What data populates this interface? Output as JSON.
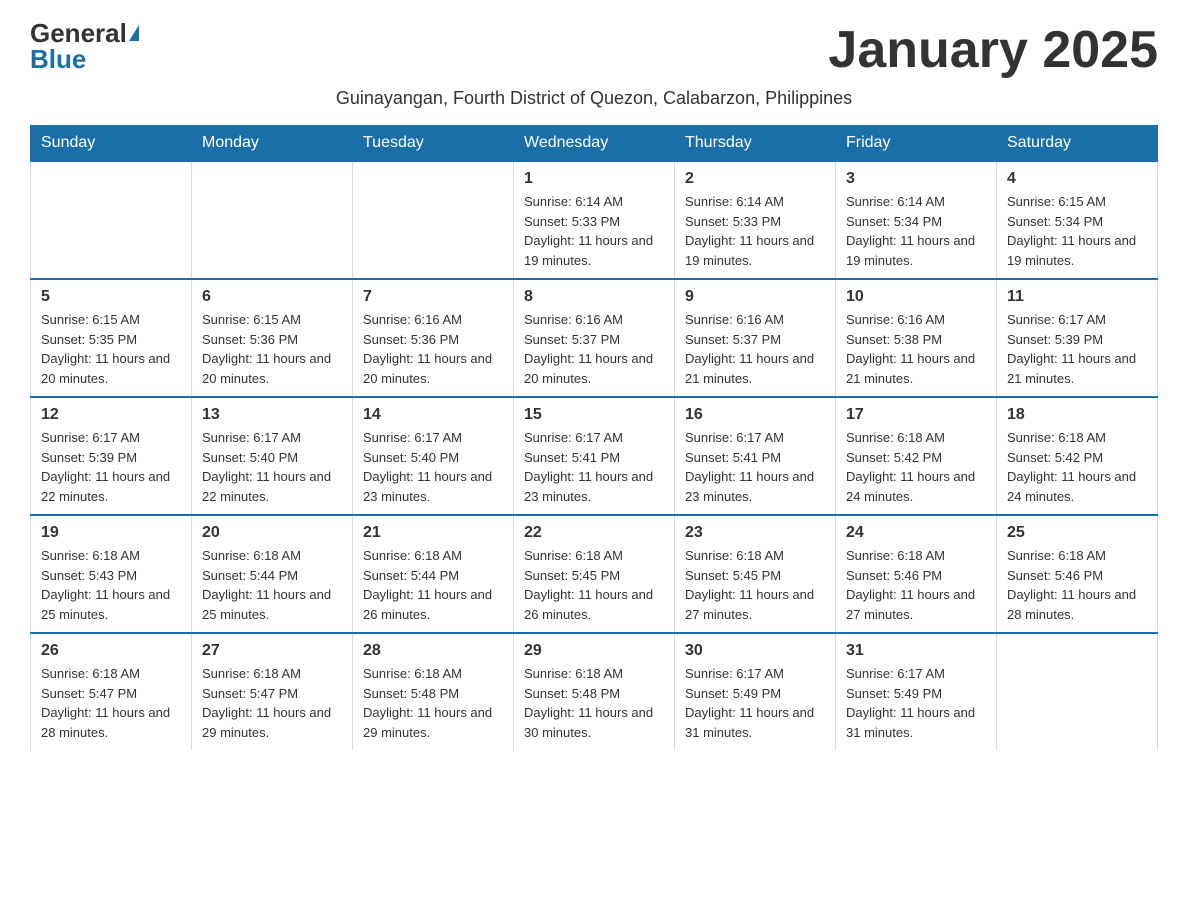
{
  "logo": {
    "general": "General",
    "blue": "Blue"
  },
  "title": "January 2025",
  "subtitle": "Guinayangan, Fourth District of Quezon, Calabarzon, Philippines",
  "days_header": [
    "Sunday",
    "Monday",
    "Tuesday",
    "Wednesday",
    "Thursday",
    "Friday",
    "Saturday"
  ],
  "weeks": [
    [
      {
        "day": "",
        "info": ""
      },
      {
        "day": "",
        "info": ""
      },
      {
        "day": "",
        "info": ""
      },
      {
        "day": "1",
        "info": "Sunrise: 6:14 AM\nSunset: 5:33 PM\nDaylight: 11 hours and 19 minutes."
      },
      {
        "day": "2",
        "info": "Sunrise: 6:14 AM\nSunset: 5:33 PM\nDaylight: 11 hours and 19 minutes."
      },
      {
        "day": "3",
        "info": "Sunrise: 6:14 AM\nSunset: 5:34 PM\nDaylight: 11 hours and 19 minutes."
      },
      {
        "day": "4",
        "info": "Sunrise: 6:15 AM\nSunset: 5:34 PM\nDaylight: 11 hours and 19 minutes."
      }
    ],
    [
      {
        "day": "5",
        "info": "Sunrise: 6:15 AM\nSunset: 5:35 PM\nDaylight: 11 hours and 20 minutes."
      },
      {
        "day": "6",
        "info": "Sunrise: 6:15 AM\nSunset: 5:36 PM\nDaylight: 11 hours and 20 minutes."
      },
      {
        "day": "7",
        "info": "Sunrise: 6:16 AM\nSunset: 5:36 PM\nDaylight: 11 hours and 20 minutes."
      },
      {
        "day": "8",
        "info": "Sunrise: 6:16 AM\nSunset: 5:37 PM\nDaylight: 11 hours and 20 minutes."
      },
      {
        "day": "9",
        "info": "Sunrise: 6:16 AM\nSunset: 5:37 PM\nDaylight: 11 hours and 21 minutes."
      },
      {
        "day": "10",
        "info": "Sunrise: 6:16 AM\nSunset: 5:38 PM\nDaylight: 11 hours and 21 minutes."
      },
      {
        "day": "11",
        "info": "Sunrise: 6:17 AM\nSunset: 5:39 PM\nDaylight: 11 hours and 21 minutes."
      }
    ],
    [
      {
        "day": "12",
        "info": "Sunrise: 6:17 AM\nSunset: 5:39 PM\nDaylight: 11 hours and 22 minutes."
      },
      {
        "day": "13",
        "info": "Sunrise: 6:17 AM\nSunset: 5:40 PM\nDaylight: 11 hours and 22 minutes."
      },
      {
        "day": "14",
        "info": "Sunrise: 6:17 AM\nSunset: 5:40 PM\nDaylight: 11 hours and 23 minutes."
      },
      {
        "day": "15",
        "info": "Sunrise: 6:17 AM\nSunset: 5:41 PM\nDaylight: 11 hours and 23 minutes."
      },
      {
        "day": "16",
        "info": "Sunrise: 6:17 AM\nSunset: 5:41 PM\nDaylight: 11 hours and 23 minutes."
      },
      {
        "day": "17",
        "info": "Sunrise: 6:18 AM\nSunset: 5:42 PM\nDaylight: 11 hours and 24 minutes."
      },
      {
        "day": "18",
        "info": "Sunrise: 6:18 AM\nSunset: 5:42 PM\nDaylight: 11 hours and 24 minutes."
      }
    ],
    [
      {
        "day": "19",
        "info": "Sunrise: 6:18 AM\nSunset: 5:43 PM\nDaylight: 11 hours and 25 minutes."
      },
      {
        "day": "20",
        "info": "Sunrise: 6:18 AM\nSunset: 5:44 PM\nDaylight: 11 hours and 25 minutes."
      },
      {
        "day": "21",
        "info": "Sunrise: 6:18 AM\nSunset: 5:44 PM\nDaylight: 11 hours and 26 minutes."
      },
      {
        "day": "22",
        "info": "Sunrise: 6:18 AM\nSunset: 5:45 PM\nDaylight: 11 hours and 26 minutes."
      },
      {
        "day": "23",
        "info": "Sunrise: 6:18 AM\nSunset: 5:45 PM\nDaylight: 11 hours and 27 minutes."
      },
      {
        "day": "24",
        "info": "Sunrise: 6:18 AM\nSunset: 5:46 PM\nDaylight: 11 hours and 27 minutes."
      },
      {
        "day": "25",
        "info": "Sunrise: 6:18 AM\nSunset: 5:46 PM\nDaylight: 11 hours and 28 minutes."
      }
    ],
    [
      {
        "day": "26",
        "info": "Sunrise: 6:18 AM\nSunset: 5:47 PM\nDaylight: 11 hours and 28 minutes."
      },
      {
        "day": "27",
        "info": "Sunrise: 6:18 AM\nSunset: 5:47 PM\nDaylight: 11 hours and 29 minutes."
      },
      {
        "day": "28",
        "info": "Sunrise: 6:18 AM\nSunset: 5:48 PM\nDaylight: 11 hours and 29 minutes."
      },
      {
        "day": "29",
        "info": "Sunrise: 6:18 AM\nSunset: 5:48 PM\nDaylight: 11 hours and 30 minutes."
      },
      {
        "day": "30",
        "info": "Sunrise: 6:17 AM\nSunset: 5:49 PM\nDaylight: 11 hours and 31 minutes."
      },
      {
        "day": "31",
        "info": "Sunrise: 6:17 AM\nSunset: 5:49 PM\nDaylight: 11 hours and 31 minutes."
      },
      {
        "day": "",
        "info": ""
      }
    ]
  ]
}
